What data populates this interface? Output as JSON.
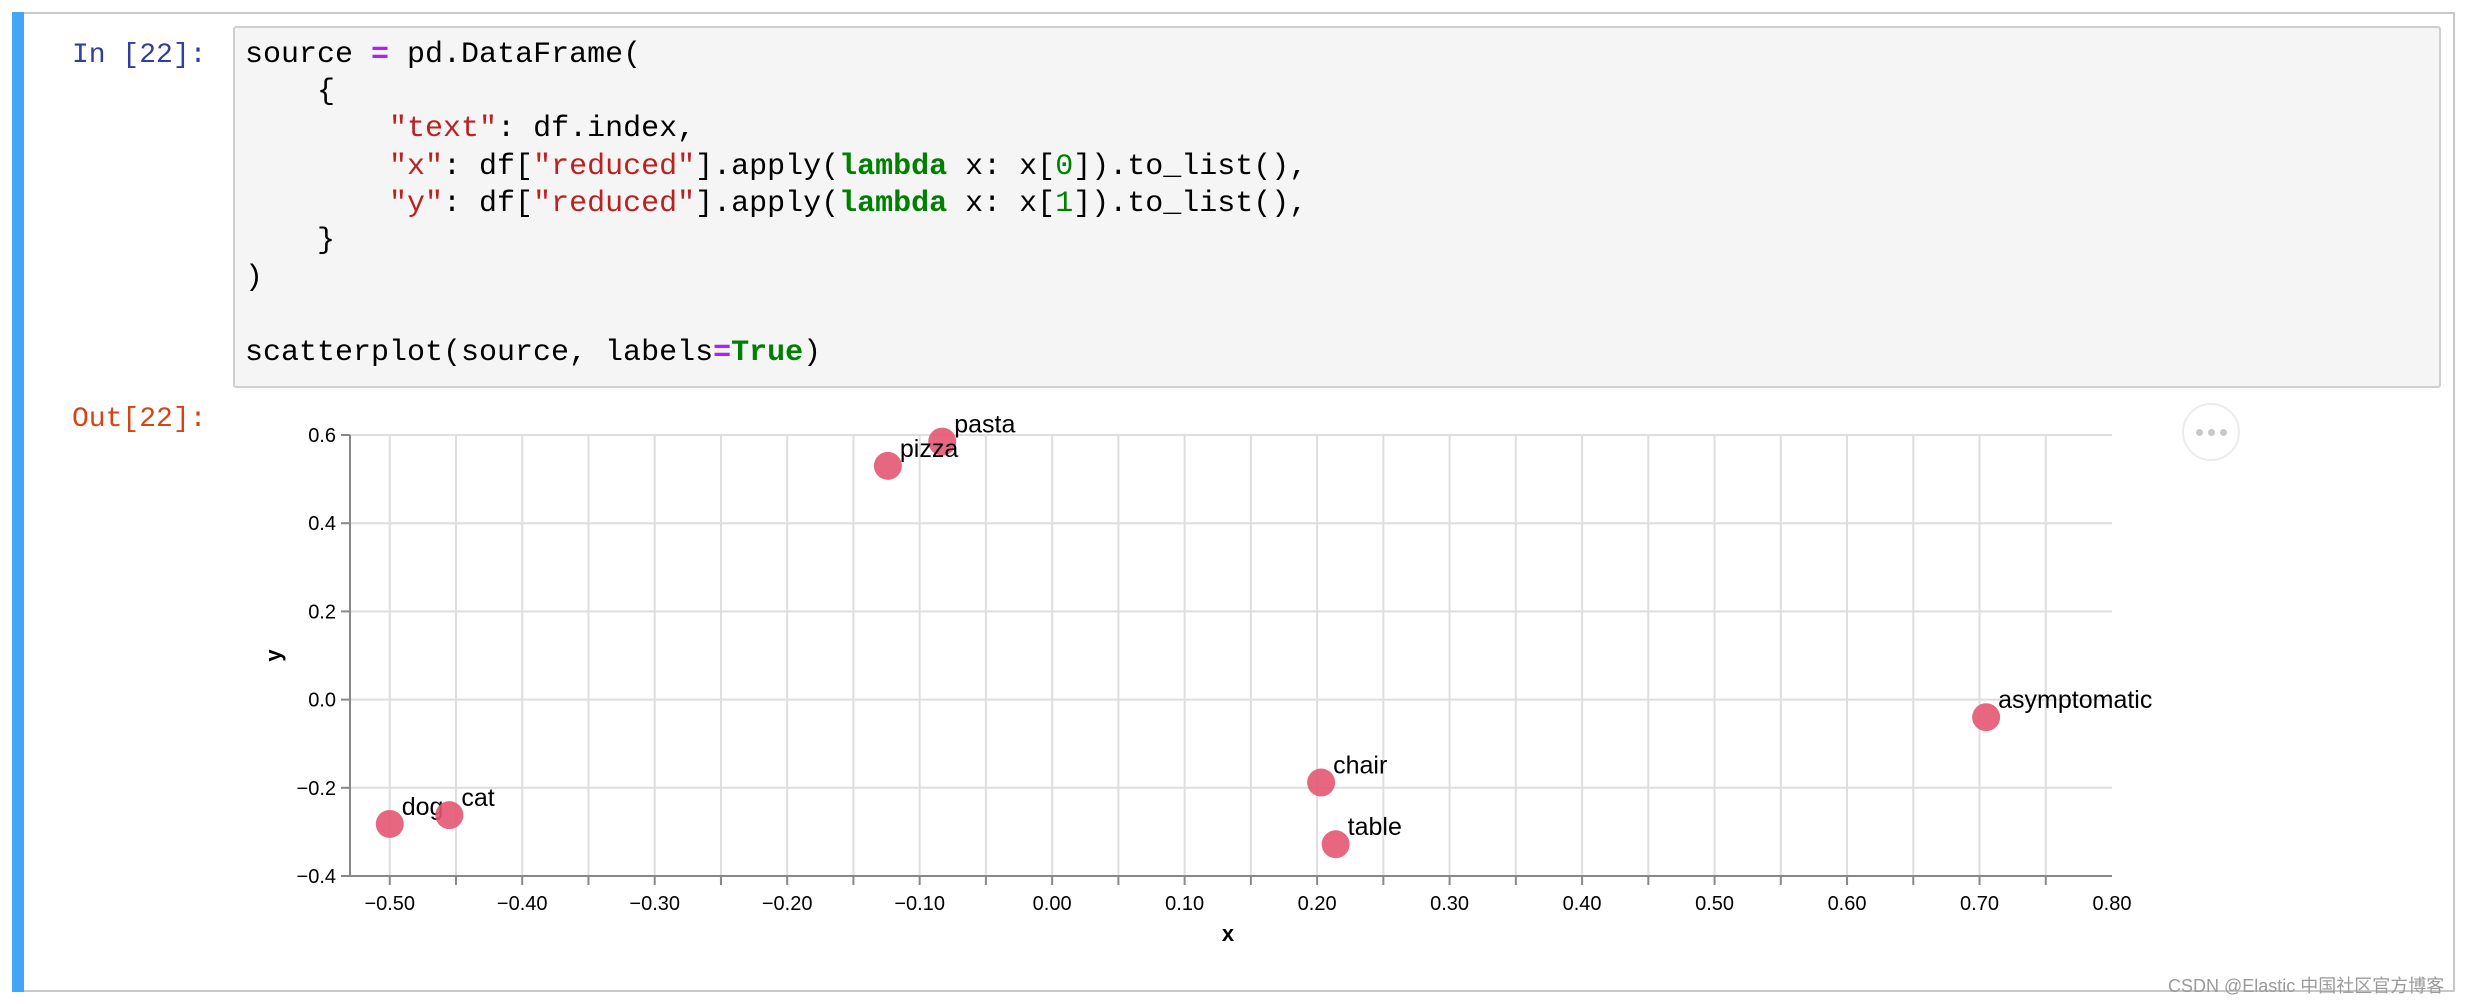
{
  "cell": {
    "in_prompt": "In [22]:",
    "out_prompt": "Out[22]:",
    "code_lines": [
      [
        {
          "t": "source "
        },
        {
          "t": "=",
          "c": "op"
        },
        {
          "t": " pd.DataFrame("
        }
      ],
      [
        {
          "t": "    {"
        }
      ],
      [
        {
          "t": "        "
        },
        {
          "t": "\"text\"",
          "c": "str"
        },
        {
          "t": ": df.index,"
        }
      ],
      [
        {
          "t": "        "
        },
        {
          "t": "\"x\"",
          "c": "str"
        },
        {
          "t": ": df["
        },
        {
          "t": "\"reduced\"",
          "c": "str"
        },
        {
          "t": "].apply("
        },
        {
          "t": "lambda",
          "c": "kw"
        },
        {
          "t": " x: x["
        },
        {
          "t": "0",
          "c": "num"
        },
        {
          "t": "]).to_list(),"
        }
      ],
      [
        {
          "t": "        "
        },
        {
          "t": "\"y\"",
          "c": "str"
        },
        {
          "t": ": df["
        },
        {
          "t": "\"reduced\"",
          "c": "str"
        },
        {
          "t": "].apply("
        },
        {
          "t": "lambda",
          "c": "kw"
        },
        {
          "t": " x: x["
        },
        {
          "t": "1",
          "c": "num"
        },
        {
          "t": "]).to_list(),"
        }
      ],
      [
        {
          "t": "    }"
        }
      ],
      [
        {
          "t": ")"
        }
      ],
      [
        {
          "t": ""
        }
      ],
      [
        {
          "t": "scatterplot(source, labels"
        },
        {
          "t": "=",
          "c": "op"
        },
        {
          "t": "True",
          "c": "kw"
        },
        {
          "t": ")"
        }
      ]
    ]
  },
  "output": {
    "more_button_icon": "ellipsis-icon"
  },
  "chart_data": {
    "type": "scatter",
    "xlabel": "x",
    "ylabel": "y",
    "xlim": [
      -0.53,
      0.8
    ],
    "ylim": [
      -0.4,
      0.6
    ],
    "x_ticks": [
      -0.5,
      -0.4,
      -0.3,
      -0.2,
      -0.1,
      0.0,
      0.1,
      0.2,
      0.3,
      0.4,
      0.5,
      0.6,
      0.7,
      0.8
    ],
    "x_tick_labels": [
      "−0.50",
      "−0.40",
      "−0.30",
      "−0.20",
      "−0.10",
      "0.00",
      "0.10",
      "0.20",
      "0.30",
      "0.40",
      "0.50",
      "0.60",
      "0.70",
      "0.80"
    ],
    "x_grid": [
      -0.5,
      -0.45,
      -0.4,
      -0.35,
      -0.3,
      -0.25,
      -0.2,
      -0.15,
      -0.1,
      -0.05,
      0.0,
      0.05,
      0.1,
      0.15,
      0.2,
      0.25,
      0.3,
      0.35,
      0.4,
      0.45,
      0.5,
      0.55,
      0.6,
      0.65,
      0.7,
      0.75
    ],
    "y_ticks": [
      -0.4,
      -0.2,
      0.0,
      0.2,
      0.4,
      0.6
    ],
    "y_tick_labels": [
      "−0.4",
      "−0.2",
      "0.0",
      "0.2",
      "0.4",
      "0.6"
    ],
    "grid": true,
    "point_color": "#e45673",
    "points": [
      {
        "text": "pasta",
        "x": -0.083,
        "y": 0.585
      },
      {
        "text": "pizza",
        "x": -0.124,
        "y": 0.53
      },
      {
        "text": "asymptomatic",
        "x": 0.705,
        "y": -0.04
      },
      {
        "text": "chair",
        "x": 0.203,
        "y": -0.188
      },
      {
        "text": "table",
        "x": 0.214,
        "y": -0.328
      },
      {
        "text": "dog",
        "x": -0.5,
        "y": -0.282
      },
      {
        "text": "cat",
        "x": -0.455,
        "y": -0.262
      }
    ]
  },
  "watermark": "CSDN @Elastic 中国社区官方博客"
}
